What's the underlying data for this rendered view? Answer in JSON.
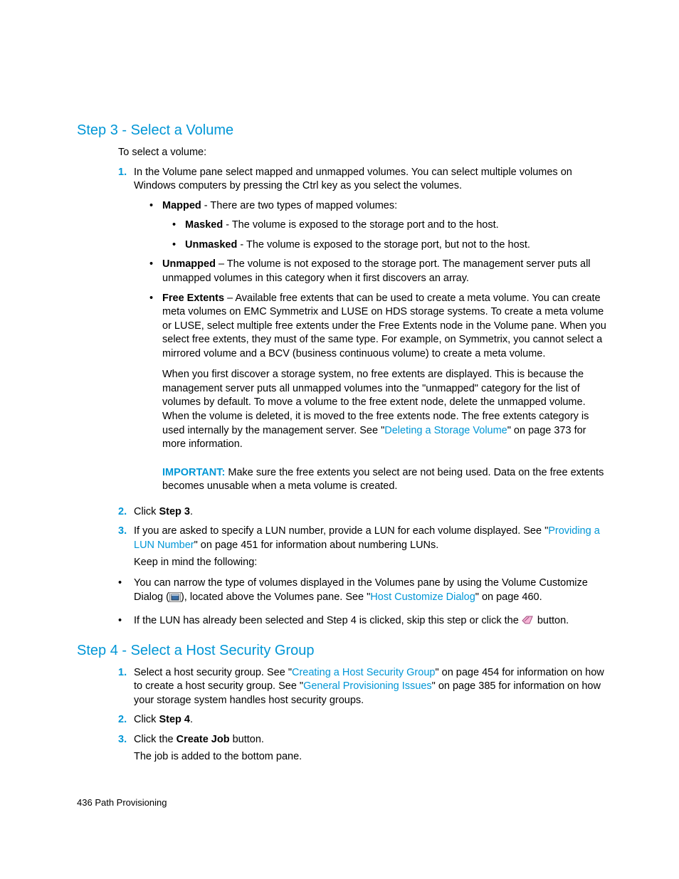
{
  "step3": {
    "heading": "Step 3 - Select a Volume",
    "intro": "To select a volume:",
    "item1": {
      "num": "1.",
      "text": "In the Volume pane select mapped and unmapped volumes. You can select multiple volumes on Windows computers by pressing the Ctrl key as you select the volumes.",
      "mapped": {
        "label": "Mapped",
        "after": " - There are two types of mapped volumes:",
        "masked": {
          "label": "Masked",
          "after": " - The volume is exposed to the storage port and to the host."
        },
        "unmasked": {
          "label": "Unmasked",
          "after": " - The volume is exposed to the storage port, but not to the host."
        }
      },
      "unmapped": {
        "label": "Unmapped",
        "after": " – The volume is not exposed to the storage port. The management server puts all unmapped volumes in this category when it first discovers an array."
      },
      "free": {
        "label": "Free Extents",
        "after": " – Available free extents that can be used to create a meta volume. You can create meta volumes on EMC Symmetrix and LUSE on HDS storage systems. To create a meta volume or LUSE, select multiple free extents under the Free Extents node in the Volume pane. When you select free extents, they must of the same type. For example, on Symmetrix, you cannot select a mirrored volume and a BCV (business continuous volume) to create a meta volume.",
        "p2a": "When you first discover a storage system, no free extents are displayed. This is because the management server puts all unmapped volumes into the \"unmapped\" category for the list of volumes by default. To move a volume to the free extent node, delete the unmapped volume. When the volume is deleted, it is moved to the free extents node. The free extents category is used internally by the management server. See \"",
        "link": "Deleting a Storage Volume",
        "p2b": "\" on page 373 for more information.",
        "imp_label": "IMPORTANT:",
        "imp_text": "   Make sure the free extents you select are not being used. Data on the free extents becomes unusable when a meta volume is created."
      }
    },
    "item2": {
      "num": "2.",
      "pre": "Click ",
      "bold": "Step 3",
      "post": "."
    },
    "item3": {
      "num": "3.",
      "pre": "If you are asked to specify a LUN number, provide a LUN for each volume displayed. See \"",
      "link": "Providing a LUN Number",
      "post": "\" on page 451 for information about numbering LUNs.",
      "keep": "Keep in mind the following:"
    },
    "extra1": {
      "pre": "You can narrow the type of volumes displayed in the Volumes pane by using the Volume Customize Dialog (",
      "mid": "), located above the Volumes pane. See \"",
      "link": "Host Customize Dialog",
      "post": "\" on page 460."
    },
    "extra2": {
      "pre": "If the LUN has already been selected and Step 4 is clicked, skip this step or click the ",
      "post": " button."
    }
  },
  "step4": {
    "heading": "Step 4 - Select a Host Security Group",
    "item1": {
      "num": "1.",
      "a": "Select a host security group. See \"",
      "link1": "Creating a Host Security Group",
      "b": "\" on page 454 for information on how to create a host security group. See \"",
      "link2": "General Provisioning Issues",
      "c": "\" on page 385 for information on how your storage system handles host security groups."
    },
    "item2": {
      "num": "2.",
      "pre": "Click ",
      "bold": "Step 4",
      "post": "."
    },
    "item3": {
      "num": "3.",
      "pre": "Click the ",
      "bold": "Create Job",
      "post": " button.",
      "after": "The job is added to the bottom pane."
    }
  },
  "footer": {
    "page": "436",
    "section": "  Path Provisioning"
  }
}
